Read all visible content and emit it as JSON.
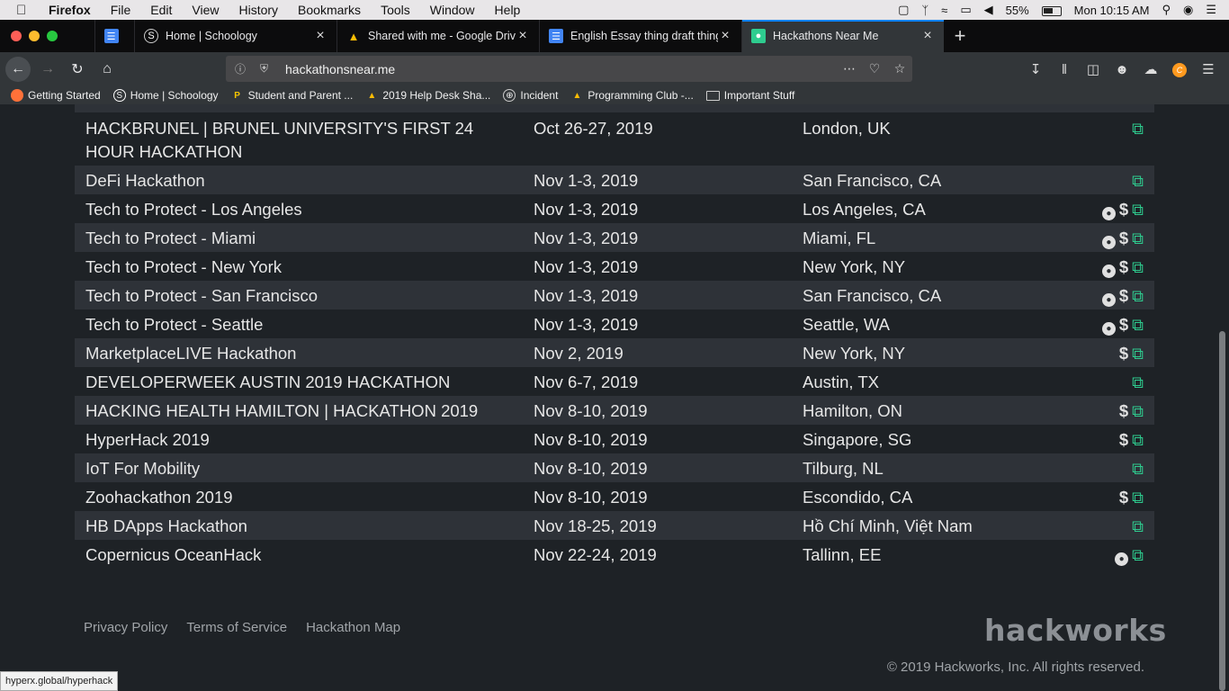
{
  "menubar": {
    "apple": "",
    "items": [
      "Firefox",
      "File",
      "Edit",
      "View",
      "History",
      "Bookmarks",
      "Tools",
      "Window",
      "Help"
    ],
    "battery": "55%",
    "clock": "Mon 10:15 AM"
  },
  "tabs": [
    {
      "label": "",
      "icon": "docs-icon"
    },
    {
      "label": "Home | Schoology",
      "icon": "schoology-icon"
    },
    {
      "label": "Shared with me - Google Drive",
      "icon": "drive-icon"
    },
    {
      "label": "English Essay thing draft thing",
      "icon": "docs-icon"
    },
    {
      "label": "Hackathons Near Me",
      "icon": "map-pin-icon"
    }
  ],
  "urlbar": {
    "url": "hackathonsnear.me"
  },
  "bookmarks": [
    {
      "label": "Getting Started",
      "icon": "firefox-icon"
    },
    {
      "label": "Home | Schoology",
      "icon": "schoology-icon"
    },
    {
      "label": "Student and Parent ...",
      "icon": "p-icon"
    },
    {
      "label": "2019 Help Desk Sha...",
      "icon": "drive-icon"
    },
    {
      "label": "Incident",
      "icon": "globe-icon"
    },
    {
      "label": "Programming Club -...",
      "icon": "drive-icon"
    },
    {
      "label": "Important Stuff",
      "icon": "folder-icon"
    }
  ],
  "events": [
    {
      "name": "HACKBRUNEL | BRUNEL UNIVERSITY'S FIRST 24 HOUR HACKATHON",
      "date": "Oct 26-27, 2019",
      "location": "London, UK",
      "online": false,
      "prizes": false
    },
    {
      "name": "DeFi Hackathon",
      "date": "Nov 1-3, 2019",
      "location": "San Francisco, CA",
      "online": false,
      "prizes": false
    },
    {
      "name": "Tech to Protect - Los Angeles",
      "date": "Nov 1-3, 2019",
      "location": "Los Angeles, CA",
      "online": true,
      "prizes": true
    },
    {
      "name": "Tech to Protect - Miami",
      "date": "Nov 1-3, 2019",
      "location": "Miami, FL",
      "online": true,
      "prizes": true
    },
    {
      "name": "Tech to Protect - New York",
      "date": "Nov 1-3, 2019",
      "location": "New York, NY",
      "online": true,
      "prizes": true
    },
    {
      "name": "Tech to Protect - San Francisco",
      "date": "Nov 1-3, 2019",
      "location": "San Francisco, CA",
      "online": true,
      "prizes": true
    },
    {
      "name": "Tech to Protect - Seattle",
      "date": "Nov 1-3, 2019",
      "location": "Seattle, WA",
      "online": true,
      "prizes": true
    },
    {
      "name": "MarketplaceLIVE Hackathon",
      "date": "Nov 2, 2019",
      "location": "New York, NY",
      "online": false,
      "prizes": true
    },
    {
      "name": "DEVELOPERWEEK AUSTIN 2019 HACKATHON",
      "date": "Nov 6-7, 2019",
      "location": "Austin, TX",
      "online": false,
      "prizes": false
    },
    {
      "name": "HACKING HEALTH HAMILTON | HACKATHON 2019",
      "date": "Nov 8-10, 2019",
      "location": "Hamilton, ON",
      "online": false,
      "prizes": true
    },
    {
      "name": "HyperHack 2019",
      "date": "Nov 8-10, 2019",
      "location": "Singapore, SG",
      "online": false,
      "prizes": true
    },
    {
      "name": "IoT For Mobility",
      "date": "Nov 8-10, 2019",
      "location": "Tilburg, NL",
      "online": false,
      "prizes": false
    },
    {
      "name": "Zoohackathon 2019",
      "date": "Nov 8-10, 2019",
      "location": "Escondido, CA",
      "online": false,
      "prizes": true
    },
    {
      "name": "HB DApps Hackathon",
      "date": "Nov 18-25, 2019",
      "location": "Hồ Chí Minh, Việt Nam",
      "online": false,
      "prizes": false
    },
    {
      "name": "Copernicus OceanHack",
      "date": "Nov 22-24, 2019",
      "location": "Tallinn, EE",
      "online": true,
      "prizes": false
    }
  ],
  "footer": {
    "links": [
      "Privacy Policy",
      "Terms of Service",
      "Hackathon Map"
    ],
    "logo": "hackworks",
    "copyright": "© 2019 Hackworks, Inc. All rights reserved."
  },
  "statusbar": {
    "text": "hyperx.global/hyperhack"
  },
  "colors": {
    "accent": "#2ecc8f",
    "background": "#1e2226",
    "row_alt": "#2e3238",
    "tab_highlight": "#0a84ff"
  }
}
